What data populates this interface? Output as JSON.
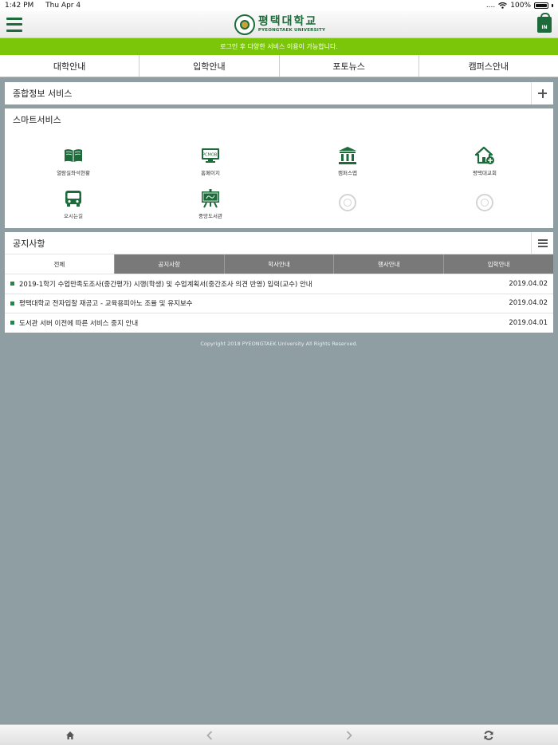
{
  "status_bar": {
    "time": "1:42 PM",
    "date": "Thu Apr 4",
    "signal": "....",
    "battery": "100%"
  },
  "header": {
    "logo_korean": "평택대학교",
    "logo_english": "PYEONGTAEK UNIVERSITY",
    "login_label": "IN",
    "icons": {
      "menu": "hamburger-menu-icon",
      "login": "lock-login-icon"
    }
  },
  "notice_bar": {
    "text": "로그인 후 다양한 서비스 이용이 가능합니다."
  },
  "top_nav": {
    "items": [
      {
        "label": "대학안내"
      },
      {
        "label": "입학안내"
      },
      {
        "label": "포토뉴스"
      },
      {
        "label": "캠퍼스안내"
      }
    ]
  },
  "info_service": {
    "title": "종합정보 서비스"
  },
  "smart_service": {
    "title": "스마트서비스",
    "items": [
      {
        "label": "열람실좌석현황",
        "icon": "book-icon"
      },
      {
        "label": "홈페이지",
        "icon": "monitor-icon",
        "badge": "PCMOBI"
      },
      {
        "label": "캠퍼스맵",
        "icon": "building-icon"
      },
      {
        "label": "평택대교회",
        "icon": "church-home-icon"
      },
      {
        "label": "오시는길",
        "icon": "bus-icon"
      },
      {
        "label": "중앙도서관",
        "icon": "library-board-icon"
      },
      {
        "label": "",
        "icon": "placeholder-seal-icon"
      },
      {
        "label": "",
        "icon": "placeholder-seal-icon"
      }
    ]
  },
  "notices": {
    "title": "공지사항",
    "tabs": [
      {
        "label": "전체",
        "active": true
      },
      {
        "label": "공지사항",
        "active": false
      },
      {
        "label": "학사안내",
        "active": false
      },
      {
        "label": "행사안내",
        "active": false
      },
      {
        "label": "입학안내",
        "active": false
      }
    ],
    "items": [
      {
        "title": "2019-1학기 수업만족도조사(중간평가) 시행(학생) 및 수업계획서(중간조사 의견 반영) 입력(교수) 안내",
        "date": "2019.04.02"
      },
      {
        "title": "평택대학교 전자입찰 재공고 - 교육용피아노 조율 및 유지보수",
        "date": "2019.04.02"
      },
      {
        "title": "도서관 서버 이전에 따른 서비스 중지 안내",
        "date": "2019.04.01"
      }
    ]
  },
  "footer": {
    "copyright": "Copyright 2018 PYEONGTAEK University All Rights Reserved."
  },
  "bottom_bar": {
    "icons": [
      "home-icon",
      "back-chevron-icon",
      "forward-chevron-icon",
      "refresh-icon"
    ]
  },
  "colors": {
    "brand_green": "#1d6b3a",
    "notice_green": "#7cc60a",
    "tab_gray": "#797979",
    "background": "#8e9ea3"
  }
}
